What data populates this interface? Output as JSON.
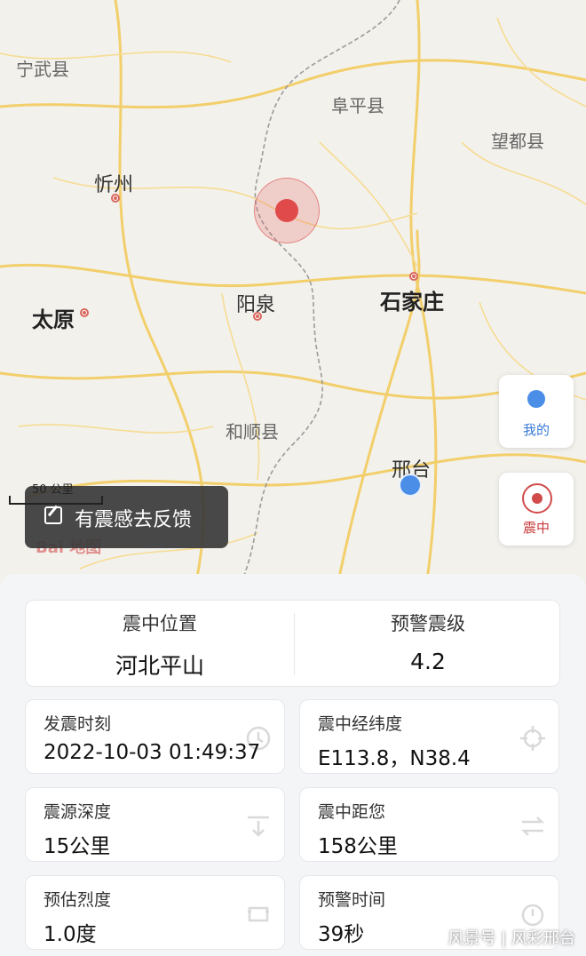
{
  "map": {
    "places": {
      "ningwu": "宁武县",
      "fuping": "阜平县",
      "wangdu": "望都县",
      "xinzhou": "忻州",
      "taiyuan": "太原",
      "yangquan": "阳泉",
      "shijiazhuang": "石家庄",
      "heshun": "和顺县",
      "xingtai": "邢台"
    },
    "scale_label": "50 公里",
    "feedback_label": "有震感去反馈",
    "baidu_logo": "Bai 地图",
    "side_buttons": {
      "me_label": "我的",
      "epicenter_label": "震中"
    }
  },
  "summary": {
    "location_label": "震中位置",
    "location_value": "河北平山",
    "magnitude_label": "预警震级",
    "magnitude_value": "4.2"
  },
  "details": [
    {
      "label": "发震时刻",
      "value": "2022-10-03 01:49:37",
      "icon": "clock-icon"
    },
    {
      "label": "震中经纬度",
      "value": "E113.8，N38.4",
      "icon": "crosshair-icon"
    },
    {
      "label": "震源深度",
      "value": "15公里",
      "icon": "depth-icon"
    },
    {
      "label": "震中距您",
      "value": "158公里",
      "icon": "distance-icon"
    },
    {
      "label": "预估烈度",
      "value": "1.0度",
      "icon": "intensity-icon"
    },
    {
      "label": "预警时间",
      "value": "39秒",
      "icon": "timer-icon"
    }
  ],
  "watermark": "风景号 | 风彩邢台",
  "colors": {
    "epicenter": "#e04a4a",
    "user_location": "#4a8ee8",
    "road": "#f2cf6b"
  }
}
